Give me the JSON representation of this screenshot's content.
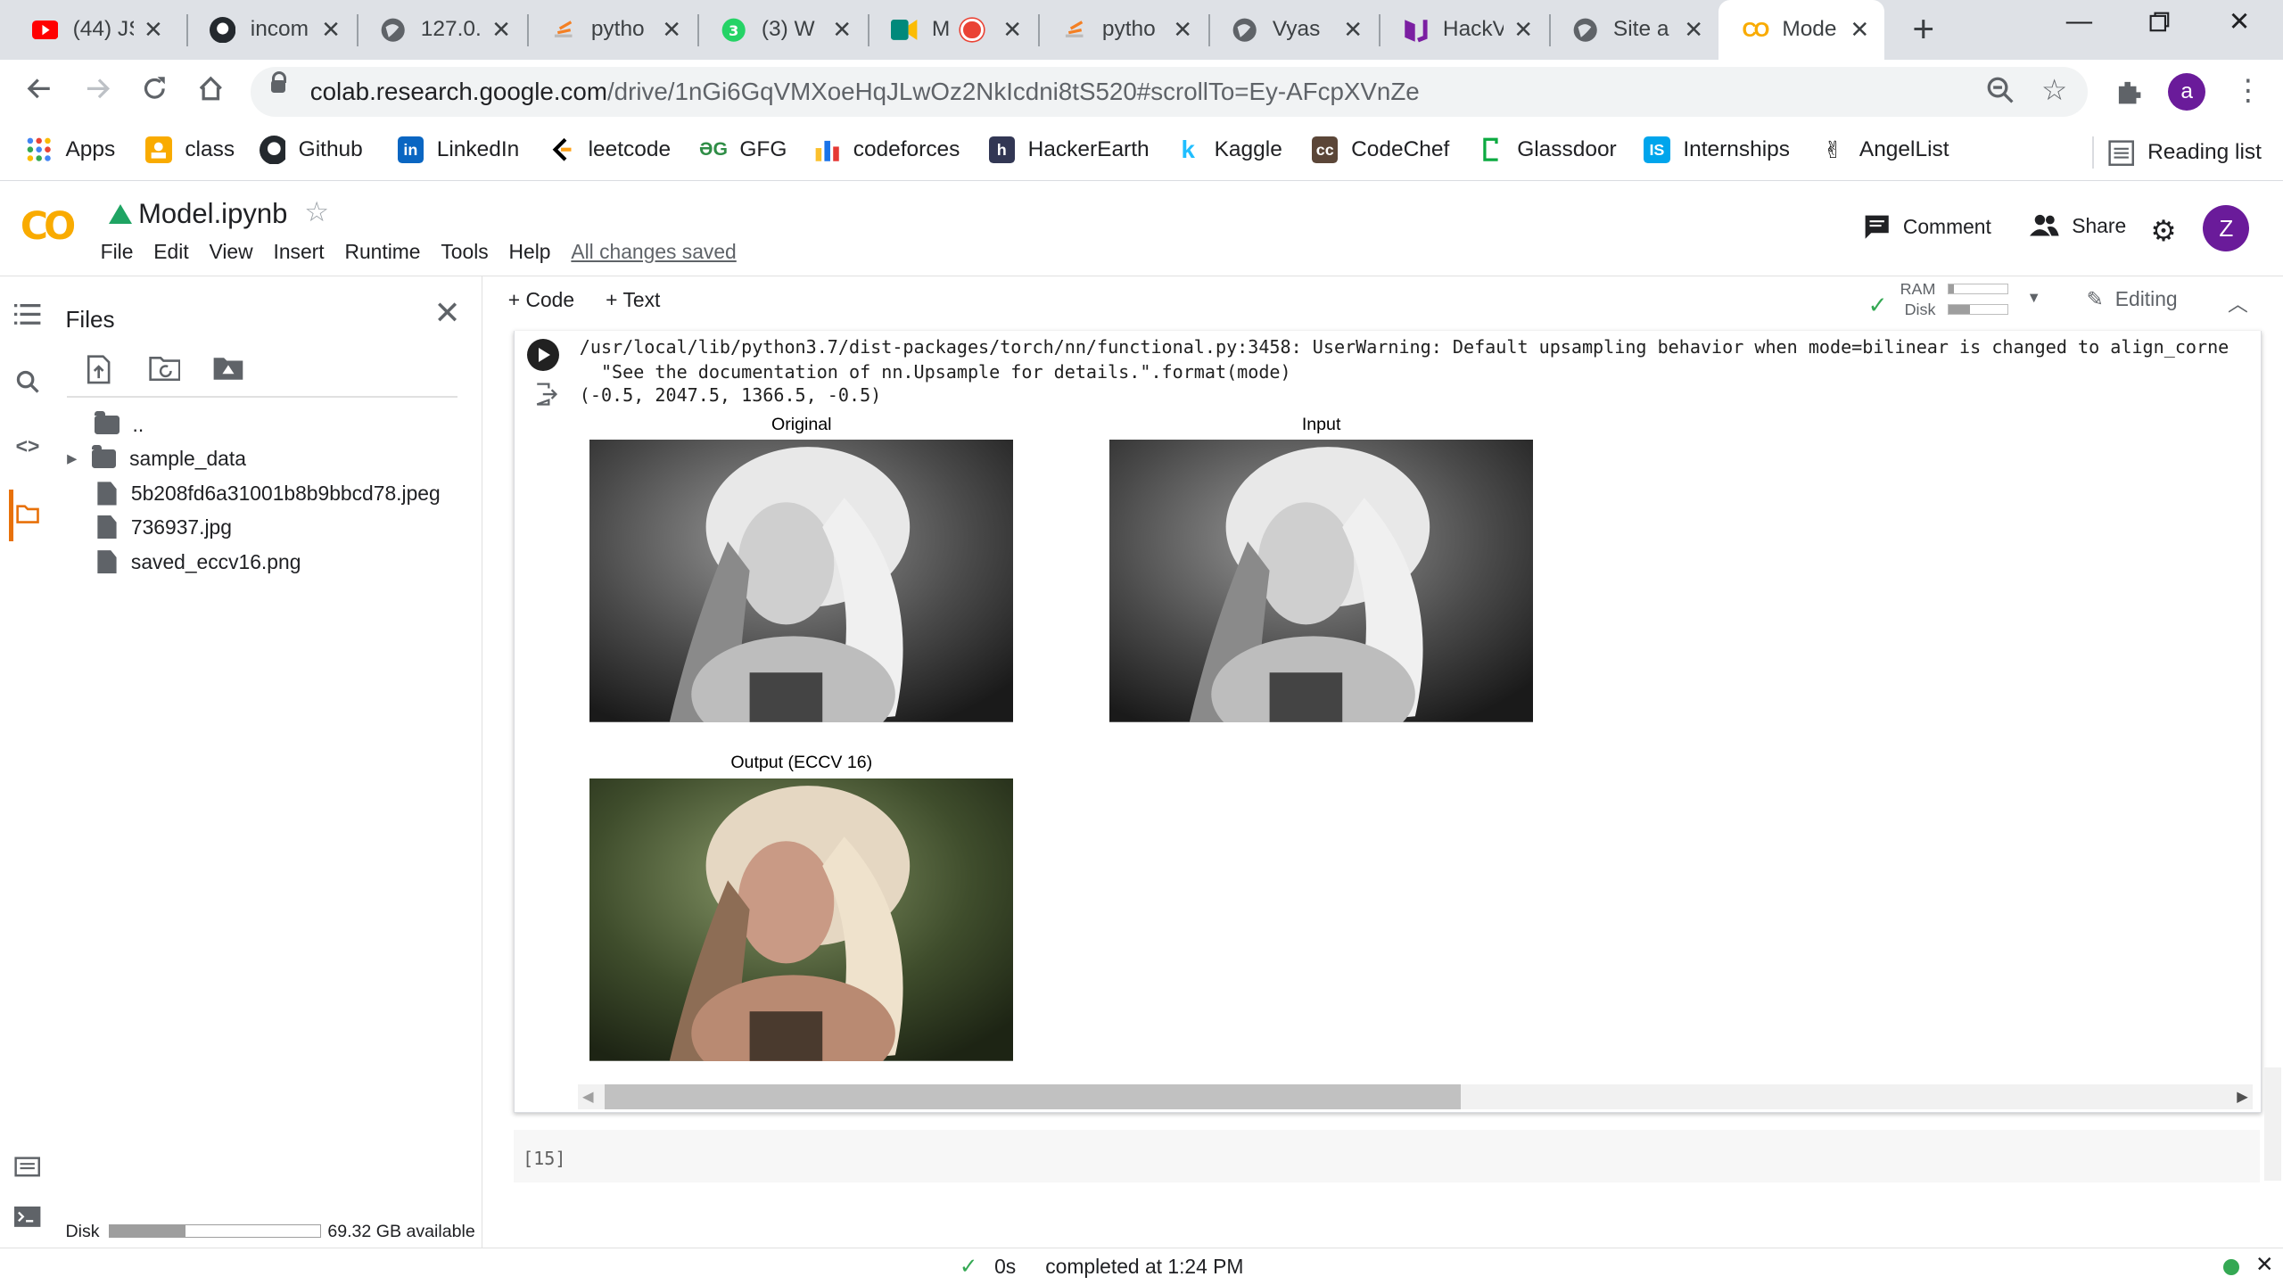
{
  "tabs": [
    {
      "title": "(44) JS",
      "icon": "youtube-icon",
      "color": "#ff0000"
    },
    {
      "title": "incom",
      "icon": "github-icon",
      "color": "#24292e"
    },
    {
      "title": "127.0.",
      "icon": "globe-icon",
      "color": "#5f6368"
    },
    {
      "title": "pytho",
      "icon": "stackoverflow-icon",
      "color": "#f48024"
    },
    {
      "title": "(3) W",
      "icon": "whatsapp-icon",
      "color": "#25d366"
    },
    {
      "title": "M",
      "icon": "meet-icon",
      "color": "#00897b"
    },
    {
      "title": "pytho",
      "icon": "stackoverflow-icon",
      "color": "#f48024"
    },
    {
      "title": "Vyas",
      "icon": "globe-icon",
      "color": "#5f6368"
    },
    {
      "title": "HackV",
      "icon": "hackerrank-icon",
      "color": "#7b1fa2"
    },
    {
      "title": "Site a",
      "icon": "globe-icon",
      "color": "#5f6368"
    },
    {
      "title": "Mode",
      "icon": "colab-icon",
      "color": "#f9ab00"
    }
  ],
  "omnibox": {
    "host": "colab.research.google.com",
    "path": "/drive/1nGi6GqVMXoeHqJLwOz2NkIcdni8tS520#scrollTo=Ey-AFcpXVnZe"
  },
  "profile_initial": "a",
  "bookmarks": [
    {
      "label": "Apps",
      "icon": "apps-icon",
      "color": "#4285f4"
    },
    {
      "label": "class",
      "icon": "classroom-icon",
      "color": "#f9ab00"
    },
    {
      "label": "Github",
      "icon": "github-icon",
      "color": "#24292e"
    },
    {
      "label": "LinkedIn",
      "icon": "linkedin-icon",
      "color": "#0a66c2"
    },
    {
      "label": "leetcode",
      "icon": "leetcode-icon",
      "color": "#ffa116"
    },
    {
      "label": "GFG",
      "icon": "gfg-icon",
      "color": "#2f8d46"
    },
    {
      "label": "codeforces",
      "icon": "codeforces-icon",
      "color": "#1a73e8"
    },
    {
      "label": "HackerEarth",
      "icon": "hackerearth-icon",
      "color": "#323754"
    },
    {
      "label": "Kaggle",
      "icon": "kaggle-icon",
      "color": "#20beff"
    },
    {
      "label": "CodeChef",
      "icon": "codechef-icon",
      "color": "#5b4638"
    },
    {
      "label": "Glassdoor",
      "icon": "glassdoor-icon",
      "color": "#0caa41"
    },
    {
      "label": "Internships",
      "icon": "internshala-icon",
      "color": "#00a5ec"
    },
    {
      "label": "AngelList",
      "icon": "angellist-icon",
      "color": "#000000"
    }
  ],
  "reading_list": "Reading list",
  "colab": {
    "logo": "CO",
    "notebook_name": "Model.ipynb",
    "menu": [
      "File",
      "Edit",
      "View",
      "Insert",
      "Runtime",
      "Tools",
      "Help"
    ],
    "saved_status": "All changes saved",
    "comment": "Comment",
    "share": "Share",
    "avatar": "Z",
    "add_code": "+ Code",
    "add_text": "+ Text",
    "ram_label": "RAM",
    "disk_label": "Disk",
    "editing": "Editing"
  },
  "files_panel": {
    "title": "Files",
    "parent": "..",
    "items": [
      {
        "name": "sample_data",
        "type": "folder"
      },
      {
        "name": "5b208fd6a31001b8b9bbcd78.jpeg",
        "type": "file"
      },
      {
        "name": "736937.jpg",
        "type": "file"
      },
      {
        "name": "saved_eccv16.png",
        "type": "file"
      }
    ],
    "disk_label": "Disk",
    "disk_available": "69.32 GB available",
    "disk_used_fraction": 0.36
  },
  "output": {
    "warning_line1": "/usr/local/lib/python3.7/dist-packages/torch/nn/functional.py:3458: UserWarning: Default upsampling behavior when mode=bilinear is changed to align_corne",
    "warning_line2": "  \"See the documentation of nn.Upsample for details.\".format(mode)",
    "result_line": "(-0.5, 2047.5, 1366.5, -0.5)",
    "plots": [
      {
        "title": "Original"
      },
      {
        "title": "Input"
      },
      {
        "title": "Output (ECCV 16)"
      }
    ]
  },
  "next_cell_label": "[15]",
  "status": {
    "duration": "0s",
    "completed": "completed at 1:24 PM"
  }
}
